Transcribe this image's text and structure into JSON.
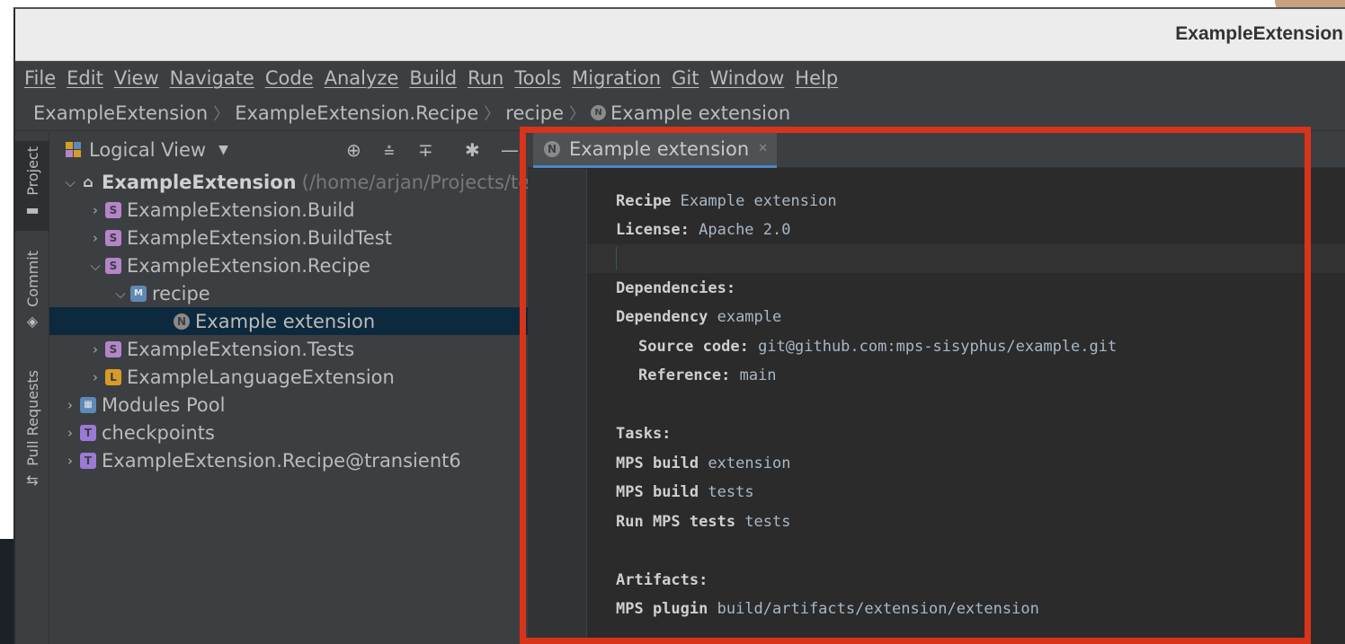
{
  "window": {
    "title": "ExampleExtension"
  },
  "menu": [
    "File",
    "Edit",
    "View",
    "Navigate",
    "Code",
    "Analyze",
    "Build",
    "Run",
    "Tools",
    "Migration",
    "Git",
    "Window",
    "Help"
  ],
  "breadcrumb": [
    "ExampleExtension",
    "ExampleExtension.Recipe",
    "recipe",
    "Example extension"
  ],
  "toolstrip": {
    "project": "Project",
    "commit": "Commit",
    "pull_requests": "Pull Requests"
  },
  "project_panel": {
    "view_label": "Logical View",
    "root": {
      "label": "ExampleExtension",
      "path": "(/home/arjan/Projects/te"
    },
    "rows": [
      {
        "label": "ExampleExtension.Build",
        "icon": "S"
      },
      {
        "label": "ExampleExtension.BuildTest",
        "icon": "S"
      },
      {
        "label": "ExampleExtension.Recipe",
        "icon": "S"
      },
      {
        "label": "recipe",
        "icon": "M"
      },
      {
        "label": "Example extension",
        "icon": "N"
      },
      {
        "label": "ExampleExtension.Tests",
        "icon": "S"
      },
      {
        "label": "ExampleLanguageExtension",
        "icon": "L"
      },
      {
        "label": "Modules Pool",
        "icon": "pool"
      },
      {
        "label": "checkpoints",
        "icon": "T"
      },
      {
        "label": "ExampleExtension.Recipe@transient6",
        "icon": "T"
      }
    ]
  },
  "editor": {
    "tab_title": "Example extension",
    "lines": {
      "recipe_kw": "Recipe",
      "recipe_val": " Example extension",
      "license_kw": "License:",
      "license_val": " Apache 2.0",
      "deps_kw": "Dependencies:",
      "dep_kw": "Dependency",
      "dep_val": " example",
      "source_kw": "Source code:",
      "source_val": " git@github.com:mps-sisyphus/example.git",
      "ref_kw": "Reference:",
      "ref_val": " main",
      "tasks_kw": "Tasks:",
      "task1_a": "MPS ",
      "task1_kw": "build",
      "task1_val": " extension",
      "task2_a": "MPS ",
      "task2_kw": "build",
      "task2_val": " tests",
      "task3_a": "Run MPS ",
      "task3_kw": "tests",
      "task3_val": " tests",
      "artifacts_kw": "Artifacts:",
      "art_kw": "MPS plugin",
      "art_val": " build/artifacts/extension/extension"
    }
  },
  "colors": {
    "highlight": "#d8341a",
    "selection": "#0d293e",
    "editor_bg": "#2b2b2b"
  }
}
